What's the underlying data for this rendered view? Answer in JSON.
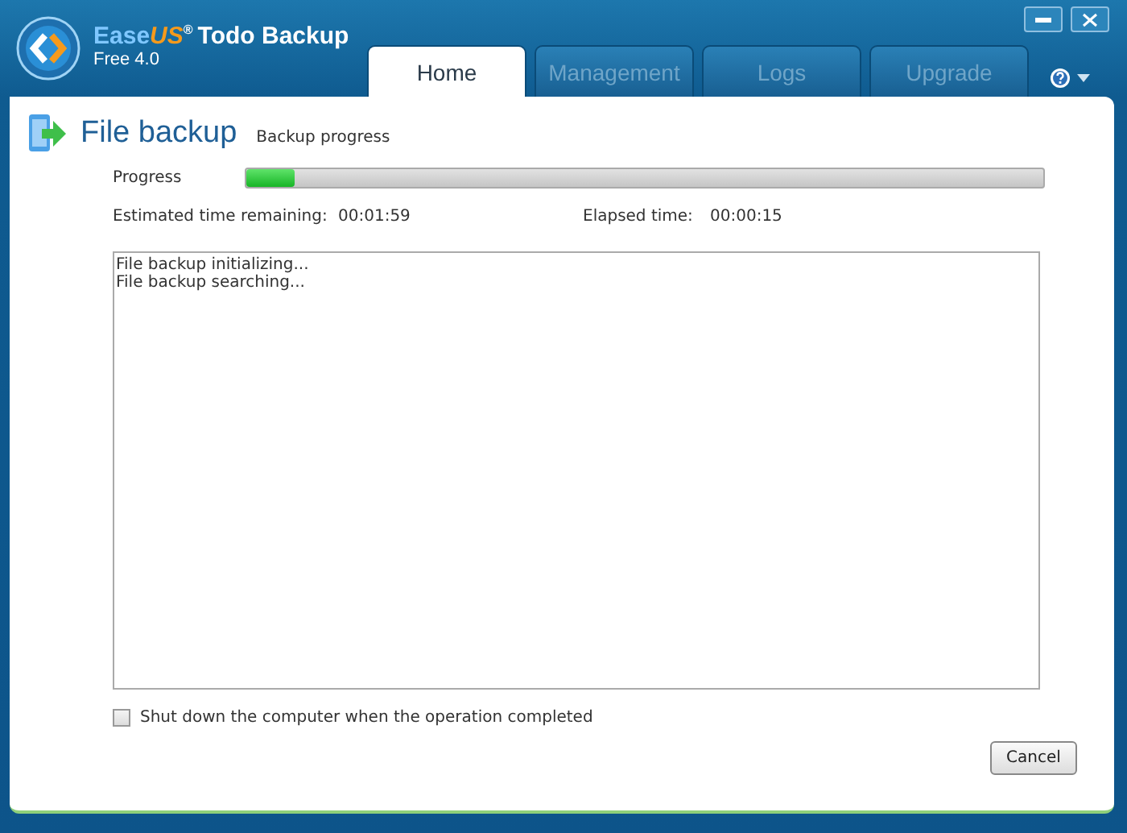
{
  "app": {
    "brand_ease": "Ease",
    "brand_us": "US",
    "brand_mark": "®",
    "brand_rest": "Todo Backup",
    "edition": "Free 4.0"
  },
  "tabs": [
    {
      "label": "Home",
      "selected": true
    },
    {
      "label": "Management",
      "selected": false
    },
    {
      "label": "Logs",
      "selected": false
    },
    {
      "label": "Upgrade",
      "selected": false
    }
  ],
  "page": {
    "title": "File backup",
    "subtitle": "Backup progress"
  },
  "progress": {
    "label": "Progress",
    "level": 0.06
  },
  "estimated": {
    "label": "Estimated time remaining:",
    "value": "00:01:59"
  },
  "elapsed": {
    "label": "Elapsed time:",
    "value": "00:00:15"
  },
  "log": [
    "File backup initializing...",
    "File backup searching..."
  ],
  "shutdown": {
    "label": "Shut down the computer when the operation completed",
    "checked": false
  },
  "buttons": [
    "Cancel"
  ]
}
